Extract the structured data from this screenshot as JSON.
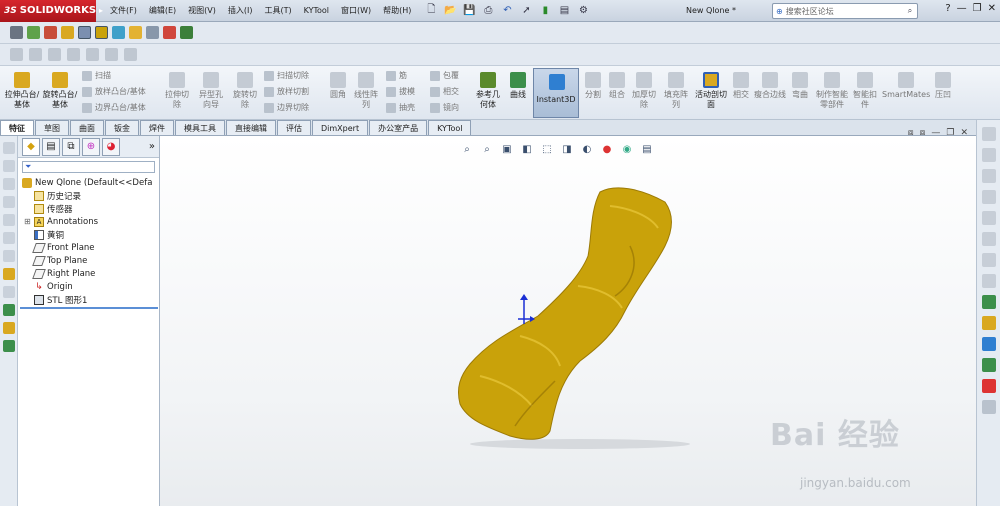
{
  "app": {
    "logo_text": "SOLIDWORKS",
    "logo_prefix": "3S",
    "document_title": "New Qlone *"
  },
  "menu": [
    "文件(F)",
    "编辑(E)",
    "视图(V)",
    "插入(I)",
    "工具(T)",
    "KYTool",
    "窗口(W)",
    "帮助(H)"
  ],
  "search": {
    "placeholder": "搜索社区论坛"
  },
  "ribbon": {
    "large_buttons": [
      {
        "label": "拉伸凸台/基体",
        "color": "#d9a820"
      },
      {
        "label": "旋转凸台/基体",
        "color": "#d9a820"
      }
    ],
    "small_group1": [
      "扫描",
      "放样凸台/基体",
      "边界凸台/基体"
    ],
    "cut_buttons": [
      "拉伸切除",
      "异型孔向导",
      "旋转切除"
    ],
    "small_group2": [
      "扫描切除",
      "放样切割",
      "边界切除"
    ],
    "mid_buttons": [
      "圆角",
      "线性阵列"
    ],
    "small_group3": [
      "筋",
      "拔模",
      "抽壳"
    ],
    "small_group4": [
      "包覆",
      "相交",
      "镜向"
    ],
    "ref_buttons": [
      "参考几何体",
      "曲线"
    ],
    "instant3d": "Instant3D",
    "right_buttons": [
      "分割",
      "组合",
      "加厚切除",
      "填充阵列",
      "活动剖切面",
      "相交",
      "瘦合边线",
      "弯曲",
      "制作智能零部件",
      "智能扣件",
      "SmartMates",
      "压凹"
    ]
  },
  "tabs": [
    "特征",
    "草图",
    "曲面",
    "钣金",
    "焊件",
    "模具工具",
    "直接编辑",
    "评估",
    "DimXpert",
    "办公室产品",
    "KYTool"
  ],
  "tree": {
    "root": "New Qlone  (Default<<Defa",
    "items": [
      {
        "label": "历史记录",
        "icon": "history-icon"
      },
      {
        "label": "传感器",
        "icon": "sensor-icon"
      },
      {
        "label": "Annotations",
        "icon": "annotations-icon"
      },
      {
        "label": "黄铜",
        "icon": "material-icon"
      },
      {
        "label": "Front Plane",
        "icon": "plane-icon"
      },
      {
        "label": "Top Plane",
        "icon": "plane-icon"
      },
      {
        "label": "Right Plane",
        "icon": "plane-icon"
      },
      {
        "label": "Origin",
        "icon": "origin-icon"
      },
      {
        "label": "STL 图形1",
        "icon": "stl-graphic-icon"
      }
    ]
  },
  "watermark": {
    "brand": "Bai 经验",
    "url": "jingyan.baidu.com"
  },
  "colors": {
    "model": "#c9a20a",
    "accent": "#2f7fd1",
    "logo": "#c8212a"
  }
}
